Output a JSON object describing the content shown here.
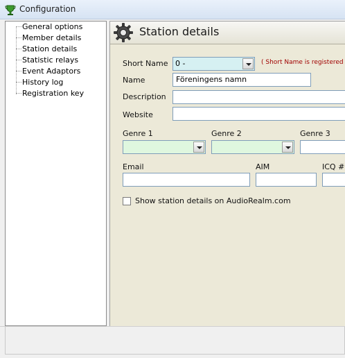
{
  "window": {
    "title": "Configuration"
  },
  "tree": {
    "items": [
      {
        "label": "General options"
      },
      {
        "label": "Member details"
      },
      {
        "label": "Station details"
      },
      {
        "label": "Statistic relays"
      },
      {
        "label": "Event Adaptors"
      },
      {
        "label": "History log"
      },
      {
        "label": "Registration key"
      }
    ]
  },
  "panel": {
    "title": "Station details"
  },
  "form": {
    "short_name_label": "Short Name",
    "short_name_value": "0 -",
    "short_name_note": "( Short Name is registered at A",
    "name_label": "Name",
    "name_value": "Föreningens namn",
    "description_label": "Description",
    "description_value": "",
    "website_label": "Website",
    "website_value": "",
    "genre1_label": "Genre 1",
    "genre1_value": "",
    "genre2_label": "Genre 2",
    "genre2_value": "",
    "genre3_label": "Genre 3",
    "genre3_value": "",
    "email_label": "Email",
    "email_value": "",
    "aim_label": "AIM",
    "aim_value": "",
    "icq_label": "ICQ #",
    "icq_value": "",
    "show_details_label": "Show station details on AudioRealm.com",
    "show_details_checked": false
  },
  "colors": {
    "short_name_bg": "#d6f0f2",
    "genre_bg": "#dff7df",
    "note_color": "#a00000"
  },
  "icons": {
    "title_icon": "trophy-icon",
    "header_icon": "gear-icon"
  }
}
